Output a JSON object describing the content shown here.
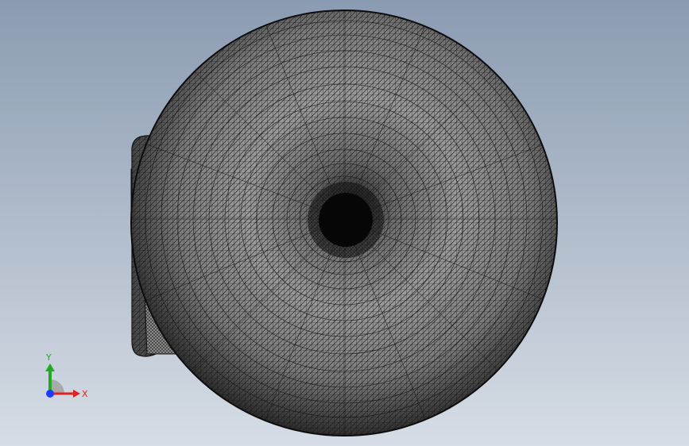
{
  "viewport": {
    "background_top": "#8b9bb2",
    "background_bottom": "#d6dde6",
    "render_mode": "wireframe-mesh",
    "mesh_color": "#111111"
  },
  "triad": {
    "y_label": "Y",
    "x_label": "X",
    "y_color": "#22aa22",
    "x_color": "#dd2222",
    "z_color": "#1a3cff"
  }
}
